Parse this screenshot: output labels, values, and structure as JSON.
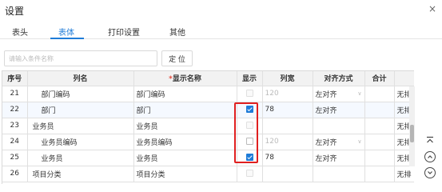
{
  "window": {
    "title": "设置",
    "close_icon": "×"
  },
  "tabs": [
    {
      "label": "表头",
      "active": false
    },
    {
      "label": "表体",
      "active": true
    },
    {
      "label": "打印设置",
      "active": false
    },
    {
      "label": "其他",
      "active": false
    }
  ],
  "search": {
    "placeholder": "请输入条件名称",
    "locate_label": "定 位"
  },
  "table": {
    "headers": {
      "seq": "序号",
      "col_name": "列名",
      "required_mark": "*",
      "display_name": "显示名称",
      "show": "显示",
      "width": "列宽",
      "align": "对齐方式",
      "total": "合计",
      "sort": "排"
    },
    "rows": [
      {
        "seq": "21",
        "col_name": "部门编码",
        "display_name": "部门编码",
        "show": false,
        "show_disabled": true,
        "width": "120",
        "align": "左对齐",
        "sort": "无排▲"
      },
      {
        "seq": "22",
        "col_name": "部门",
        "display_name": "部门",
        "show": true,
        "show_disabled": false,
        "width": "78",
        "align": "左对齐",
        "sort": "无排"
      },
      {
        "seq": "23",
        "col_name": "业务员",
        "display_name": "业务员",
        "show": false,
        "show_disabled": true,
        "width": "",
        "align": "",
        "sort": "无排"
      },
      {
        "seq": "24",
        "col_name": "业务员编码",
        "display_name": "业务员编码",
        "show": false,
        "show_disabled": false,
        "width": "120",
        "align": "左对齐",
        "sort": "无排"
      },
      {
        "seq": "25",
        "col_name": "业务员",
        "display_name": "业务员",
        "show": true,
        "show_disabled": false,
        "width": "78",
        "align": "左对齐",
        "sort": "无排"
      },
      {
        "seq": "26",
        "col_name": "项目分类",
        "display_name": "项目分类",
        "show": false,
        "show_disabled": true,
        "width": "",
        "align": "",
        "sort": "无排"
      }
    ]
  },
  "side_controls": {
    "top_icon": "⊼",
    "up_icon": "︿",
    "down_icon": "﹀"
  },
  "colors": {
    "accent": "#1f7cd8",
    "highlight_box": "#e02020",
    "required": "#e64a3b"
  }
}
